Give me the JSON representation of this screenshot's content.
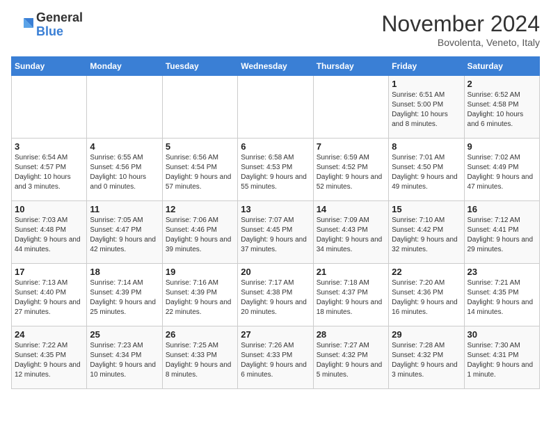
{
  "logo": {
    "general": "General",
    "blue": "Blue"
  },
  "title": "November 2024",
  "location": "Bovolenta, Veneto, Italy",
  "days_of_week": [
    "Sunday",
    "Monday",
    "Tuesday",
    "Wednesday",
    "Thursday",
    "Friday",
    "Saturday"
  ],
  "weeks": [
    [
      {
        "day": "",
        "info": ""
      },
      {
        "day": "",
        "info": ""
      },
      {
        "day": "",
        "info": ""
      },
      {
        "day": "",
        "info": ""
      },
      {
        "day": "",
        "info": ""
      },
      {
        "day": "1",
        "info": "Sunrise: 6:51 AM\nSunset: 5:00 PM\nDaylight: 10 hours and 8 minutes."
      },
      {
        "day": "2",
        "info": "Sunrise: 6:52 AM\nSunset: 4:58 PM\nDaylight: 10 hours and 6 minutes."
      }
    ],
    [
      {
        "day": "3",
        "info": "Sunrise: 6:54 AM\nSunset: 4:57 PM\nDaylight: 10 hours and 3 minutes."
      },
      {
        "day": "4",
        "info": "Sunrise: 6:55 AM\nSunset: 4:56 PM\nDaylight: 10 hours and 0 minutes."
      },
      {
        "day": "5",
        "info": "Sunrise: 6:56 AM\nSunset: 4:54 PM\nDaylight: 9 hours and 57 minutes."
      },
      {
        "day": "6",
        "info": "Sunrise: 6:58 AM\nSunset: 4:53 PM\nDaylight: 9 hours and 55 minutes."
      },
      {
        "day": "7",
        "info": "Sunrise: 6:59 AM\nSunset: 4:52 PM\nDaylight: 9 hours and 52 minutes."
      },
      {
        "day": "8",
        "info": "Sunrise: 7:01 AM\nSunset: 4:50 PM\nDaylight: 9 hours and 49 minutes."
      },
      {
        "day": "9",
        "info": "Sunrise: 7:02 AM\nSunset: 4:49 PM\nDaylight: 9 hours and 47 minutes."
      }
    ],
    [
      {
        "day": "10",
        "info": "Sunrise: 7:03 AM\nSunset: 4:48 PM\nDaylight: 9 hours and 44 minutes."
      },
      {
        "day": "11",
        "info": "Sunrise: 7:05 AM\nSunset: 4:47 PM\nDaylight: 9 hours and 42 minutes."
      },
      {
        "day": "12",
        "info": "Sunrise: 7:06 AM\nSunset: 4:46 PM\nDaylight: 9 hours and 39 minutes."
      },
      {
        "day": "13",
        "info": "Sunrise: 7:07 AM\nSunset: 4:45 PM\nDaylight: 9 hours and 37 minutes."
      },
      {
        "day": "14",
        "info": "Sunrise: 7:09 AM\nSunset: 4:43 PM\nDaylight: 9 hours and 34 minutes."
      },
      {
        "day": "15",
        "info": "Sunrise: 7:10 AM\nSunset: 4:42 PM\nDaylight: 9 hours and 32 minutes."
      },
      {
        "day": "16",
        "info": "Sunrise: 7:12 AM\nSunset: 4:41 PM\nDaylight: 9 hours and 29 minutes."
      }
    ],
    [
      {
        "day": "17",
        "info": "Sunrise: 7:13 AM\nSunset: 4:40 PM\nDaylight: 9 hours and 27 minutes."
      },
      {
        "day": "18",
        "info": "Sunrise: 7:14 AM\nSunset: 4:39 PM\nDaylight: 9 hours and 25 minutes."
      },
      {
        "day": "19",
        "info": "Sunrise: 7:16 AM\nSunset: 4:39 PM\nDaylight: 9 hours and 22 minutes."
      },
      {
        "day": "20",
        "info": "Sunrise: 7:17 AM\nSunset: 4:38 PM\nDaylight: 9 hours and 20 minutes."
      },
      {
        "day": "21",
        "info": "Sunrise: 7:18 AM\nSunset: 4:37 PM\nDaylight: 9 hours and 18 minutes."
      },
      {
        "day": "22",
        "info": "Sunrise: 7:20 AM\nSunset: 4:36 PM\nDaylight: 9 hours and 16 minutes."
      },
      {
        "day": "23",
        "info": "Sunrise: 7:21 AM\nSunset: 4:35 PM\nDaylight: 9 hours and 14 minutes."
      }
    ],
    [
      {
        "day": "24",
        "info": "Sunrise: 7:22 AM\nSunset: 4:35 PM\nDaylight: 9 hours and 12 minutes."
      },
      {
        "day": "25",
        "info": "Sunrise: 7:23 AM\nSunset: 4:34 PM\nDaylight: 9 hours and 10 minutes."
      },
      {
        "day": "26",
        "info": "Sunrise: 7:25 AM\nSunset: 4:33 PM\nDaylight: 9 hours and 8 minutes."
      },
      {
        "day": "27",
        "info": "Sunrise: 7:26 AM\nSunset: 4:33 PM\nDaylight: 9 hours and 6 minutes."
      },
      {
        "day": "28",
        "info": "Sunrise: 7:27 AM\nSunset: 4:32 PM\nDaylight: 9 hours and 5 minutes."
      },
      {
        "day": "29",
        "info": "Sunrise: 7:28 AM\nSunset: 4:32 PM\nDaylight: 9 hours and 3 minutes."
      },
      {
        "day": "30",
        "info": "Sunrise: 7:30 AM\nSunset: 4:31 PM\nDaylight: 9 hours and 1 minute."
      }
    ]
  ]
}
